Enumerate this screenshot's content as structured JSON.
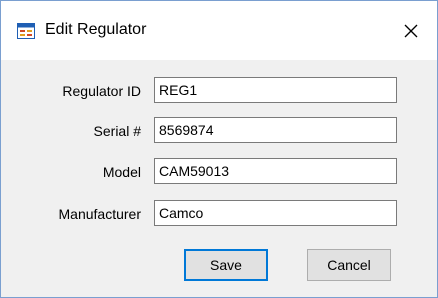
{
  "window": {
    "title": "Edit Regulator",
    "close_symbol": "×",
    "app_icon": "window-form-icon"
  },
  "form": {
    "fields": [
      {
        "label": "Regulator ID",
        "value": "REG1"
      },
      {
        "label": "Serial #",
        "value": "8569874"
      },
      {
        "label": "Model",
        "value": "CAM59013"
      },
      {
        "label": "Manufacturer",
        "value": "Camco"
      }
    ]
  },
  "buttons": {
    "save_label": "Save",
    "cancel_label": "Cancel"
  },
  "colors": {
    "accent": "#0078d7",
    "window_border": "#7a9fd0",
    "dialog_background": "#f0f0f0"
  }
}
